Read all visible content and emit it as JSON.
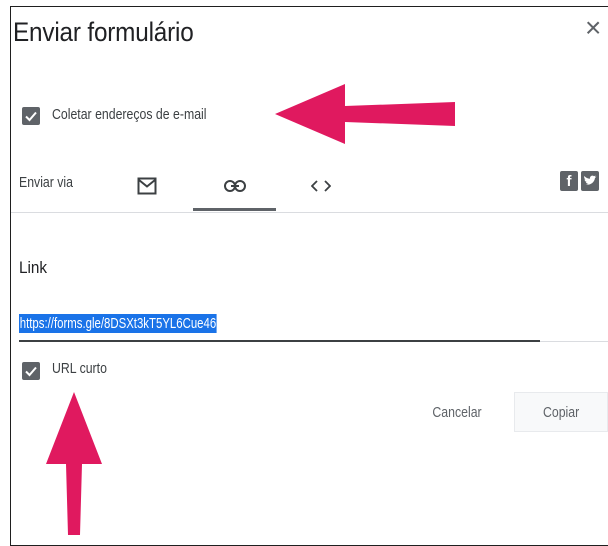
{
  "dialog": {
    "title": "Enviar formulário",
    "close_icon": "close-icon",
    "collect_emails": {
      "label": "Coletar endereços de e-mail",
      "checked": true
    },
    "send_via": {
      "label": "Enviar via",
      "tabs": [
        {
          "icon": "email-icon",
          "selected": false
        },
        {
          "icon": "link-icon",
          "selected": true
        },
        {
          "icon": "embed-icon",
          "selected": false
        }
      ],
      "share_icons": [
        "facebook-icon",
        "twitter-icon"
      ]
    },
    "link_section": {
      "heading": "Link",
      "url": "https://forms.gle/8DSXt3kT5YL6Cue46",
      "short_url": {
        "label": "URL curto",
        "checked": true
      }
    },
    "buttons": {
      "cancel": "Cancelar",
      "copy": "Copiar"
    }
  },
  "colors": {
    "annotation_arrow": "#e0195f",
    "selection": "#1a73e8",
    "icon_gray": "#5f6368"
  }
}
